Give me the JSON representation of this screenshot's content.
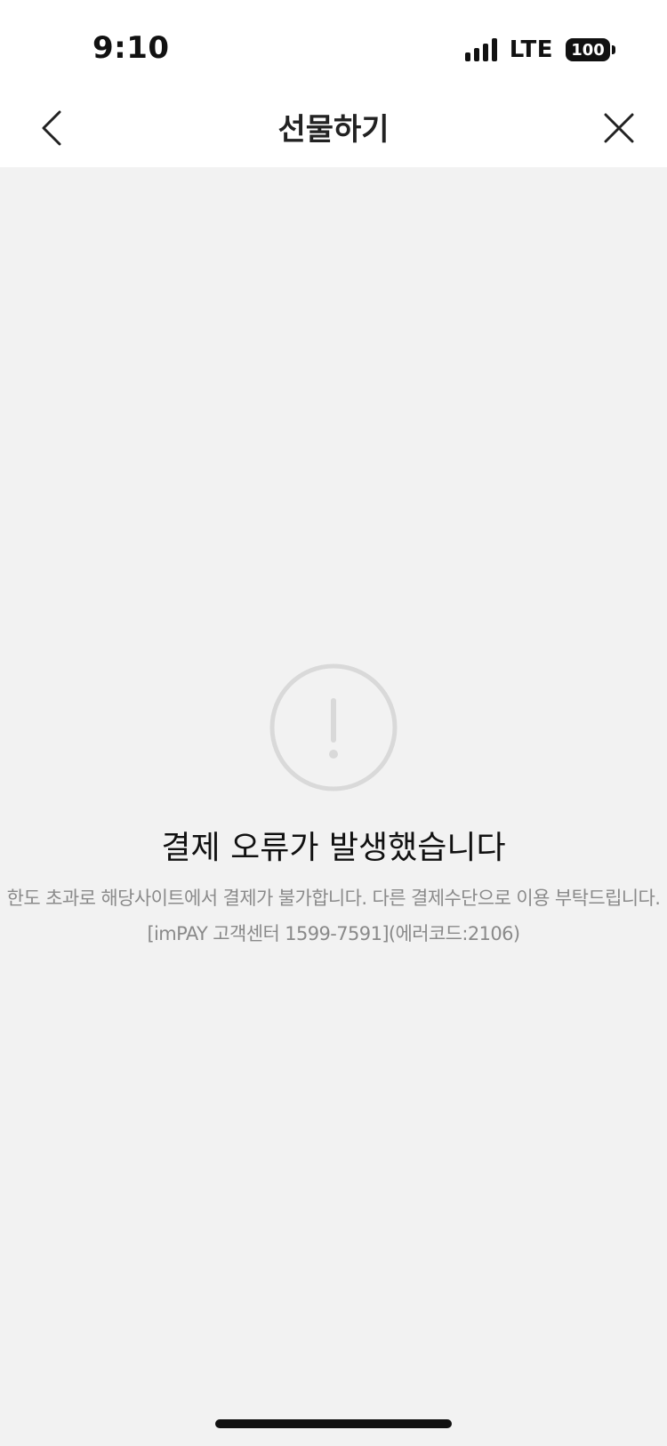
{
  "status_bar": {
    "time": "9:10",
    "network": "LTE",
    "battery": "100"
  },
  "nav": {
    "title": "선물하기",
    "back_icon": "chevron-left-icon",
    "close_icon": "close-icon"
  },
  "error": {
    "icon": "exclamation-circle-icon",
    "title": "결제 오류가 발생했습니다",
    "message": "한도 초과로 해당사이트에서 결제가 불가합니다. 다른 결제수단으로 이용 부탁드립니다.",
    "support": "[imPAY 고객센터 1599-7591](에러코드:2106)"
  },
  "colors": {
    "background": "#f2f2f2",
    "header": "#ffffff",
    "icon_gray": "#d9d9d9",
    "message_gray": "#8a8a8a"
  }
}
